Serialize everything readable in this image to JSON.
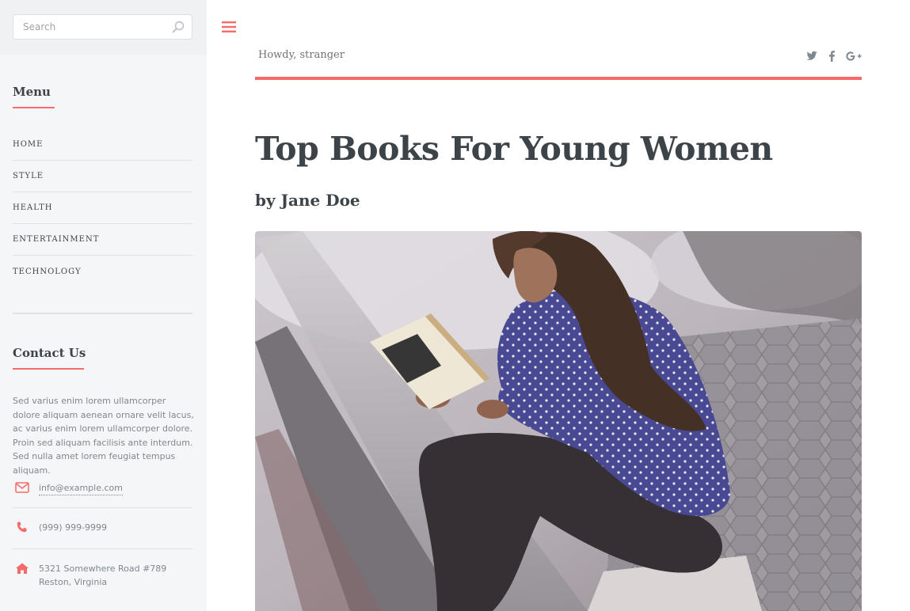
{
  "search": {
    "placeholder": "Search"
  },
  "menu": {
    "heading": "Menu",
    "items": [
      {
        "label": "HOME"
      },
      {
        "label": "STYLE"
      },
      {
        "label": "HEALTH"
      },
      {
        "label": "ENTERTAINMENT"
      },
      {
        "label": "TECHNOLOGY"
      }
    ]
  },
  "contact": {
    "heading": "Contact Us",
    "text": "Sed varius enim lorem ullamcorper dolore aliquam aenean ornare velit lacus, ac varius enim lorem ullamcorper dolore. Proin sed aliquam facilisis ante interdum. Sed nulla amet lorem feugiat tempus aliquam.",
    "email": "info@example.com",
    "phone": "(999) 999-9999",
    "address_line1": "5321 Somewhere Road #789",
    "address_line2": "Reston, Virginia"
  },
  "header": {
    "greeting": "Howdy, stranger",
    "social_icons": [
      "twitter-icon",
      "facebook-icon",
      "google-plus-icon"
    ]
  },
  "post": {
    "title": "Top Books For Young Women",
    "author": "by Jane Doe",
    "image_desc": "woman-reading-book-photo"
  },
  "colors": {
    "accent": "#f56a6a",
    "text": "#3d4449",
    "muted": "#7f888f",
    "sidebar_bg": "#f5f6f7"
  }
}
